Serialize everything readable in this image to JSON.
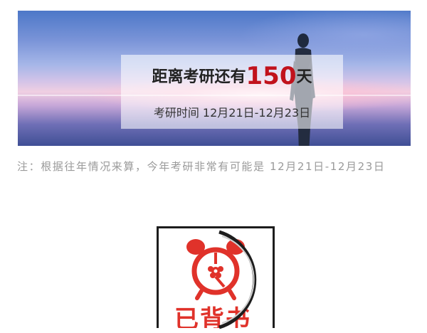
{
  "banner": {
    "headline_prefix": "距离考研还有",
    "days": "150",
    "headline_suffix": "天",
    "exam_dates": "考研时间 12月21日-12月23日"
  },
  "note": {
    "text": "注：根据往年情况来算，今年考研非常有可能是 12月21日-12月23日"
  },
  "logo": {
    "text": "已背书",
    "icon": "alarm-clock-icon"
  },
  "colors": {
    "accent_red": "#c1121c",
    "logo_red": "#e0322a",
    "note_gray": "#9a9a9a"
  }
}
